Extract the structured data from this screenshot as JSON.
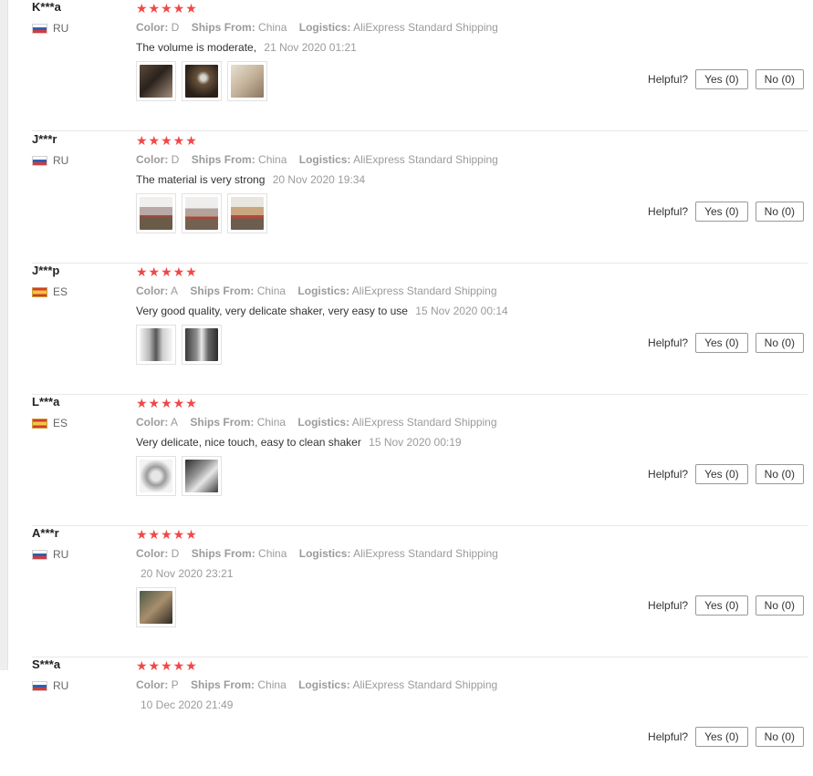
{
  "helpful_label": "Helpful?",
  "yes_label": "Yes (0)",
  "no_label": "No (0)",
  "reviews": [
    {
      "user": "K***a",
      "country": "RU",
      "stars": "★★★★★",
      "meta": {
        "color_label": "Color:",
        "color": "D",
        "ships_label": "Ships From:",
        "ships": "China",
        "logistics_label": "Logistics:",
        "logistics": "AliExpress Standard Shipping"
      },
      "text": "The volume is moderate,",
      "date": "21 Nov 2020 01:21"
    },
    {
      "user": "J***r",
      "country": "RU",
      "stars": "★★★★★",
      "meta": {
        "color_label": "Color:",
        "color": "D",
        "ships_label": "Ships From:",
        "ships": "China",
        "logistics_label": "Logistics:",
        "logistics": "AliExpress Standard Shipping"
      },
      "text": "The material is very strong",
      "date": "20 Nov 2020 19:34"
    },
    {
      "user": "J***p",
      "country": "ES",
      "stars": "★★★★★",
      "meta": {
        "color_label": "Color:",
        "color": "A",
        "ships_label": "Ships From:",
        "ships": "China",
        "logistics_label": "Logistics:",
        "logistics": "AliExpress Standard Shipping"
      },
      "text": "Very good quality, very delicate shaker, very easy to use",
      "date": "15 Nov 2020 00:14"
    },
    {
      "user": "L***a",
      "country": "ES",
      "stars": "★★★★★",
      "meta": {
        "color_label": "Color:",
        "color": "A",
        "ships_label": "Ships From:",
        "ships": "China",
        "logistics_label": "Logistics:",
        "logistics": "AliExpress Standard Shipping"
      },
      "text": "Very delicate, nice touch, easy to clean shaker",
      "date": "15 Nov 2020 00:19"
    },
    {
      "user": "A***r",
      "country": "RU",
      "stars": "★★★★★",
      "meta": {
        "color_label": "Color:",
        "color": "D",
        "ships_label": "Ships From:",
        "ships": "China",
        "logistics_label": "Logistics:",
        "logistics": "AliExpress Standard Shipping"
      },
      "text": "",
      "date": "20 Nov 2020 23:21"
    },
    {
      "user": "S***a",
      "country": "RU",
      "stars": "★★★★★",
      "meta": {
        "color_label": "Color:",
        "color": "P",
        "ships_label": "Ships From:",
        "ships": "China",
        "logistics_label": "Logistics:",
        "logistics": "AliExpress Standard Shipping"
      },
      "text": "",
      "date": "10 Dec 2020 21:49"
    }
  ]
}
